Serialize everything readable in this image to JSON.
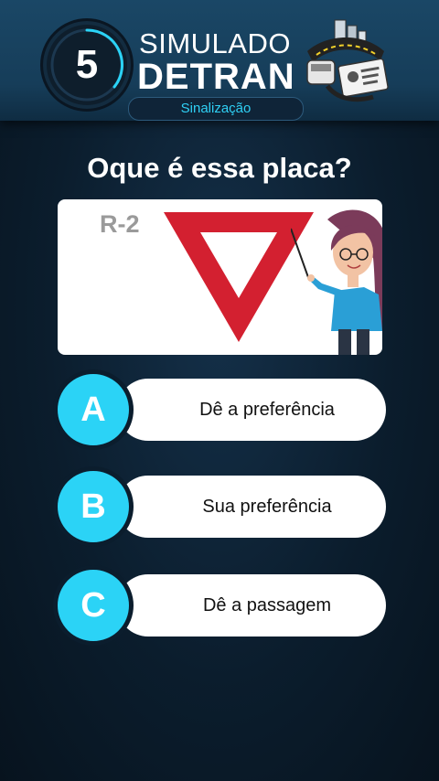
{
  "header": {
    "question_number": "5",
    "title_line1": "SIMULADO",
    "title_line2": "DETRAN",
    "category": "Sinalização",
    "logo_icon": "detran-logo-icon"
  },
  "question": {
    "text": "Oque é essa placa?",
    "sign_code": "R-2",
    "sign_icon": "yield-sign-icon",
    "illustration": "teacher-pointer-illustration"
  },
  "options": [
    {
      "letter": "A",
      "text": "Dê a preferência"
    },
    {
      "letter": "B",
      "text": "Sua preferência"
    },
    {
      "letter": "C",
      "text": "Dê a passagem"
    }
  ],
  "colors": {
    "accent": "#2bd3f6",
    "sign_red": "#d32030",
    "background": "#0b1d2d"
  }
}
